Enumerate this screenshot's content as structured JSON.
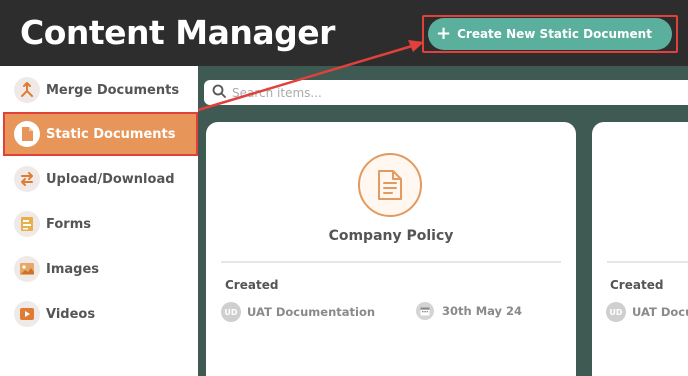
{
  "header": {
    "title": "Content Manager",
    "create_button_label": "Create New Static Document"
  },
  "sidebar": {
    "items": [
      {
        "label": "Merge Documents",
        "icon": "merge-icon"
      },
      {
        "label": "Static Documents",
        "icon": "document-icon",
        "active": true
      },
      {
        "label": "Upload/Download",
        "icon": "upload-download-icon"
      },
      {
        "label": "Forms",
        "icon": "forms-icon"
      },
      {
        "label": "Images",
        "icon": "images-icon"
      },
      {
        "label": "Videos",
        "icon": "videos-icon"
      }
    ]
  },
  "search": {
    "placeholder": "Search items..."
  },
  "cards": [
    {
      "title": "Company Policy",
      "created_label": "Created",
      "author_initials": "UD",
      "author": "UAT Documentation",
      "date": "30th May 24"
    },
    {
      "created_label": "Created",
      "author_initials": "UD",
      "author": "UAT Docum"
    }
  ],
  "colors": {
    "header_bg": "#2d2d2d",
    "accent_green": "#5ab09c",
    "active_orange": "#e8955a",
    "highlight_red": "#e0413a",
    "content_bg": "#3f5a52"
  }
}
